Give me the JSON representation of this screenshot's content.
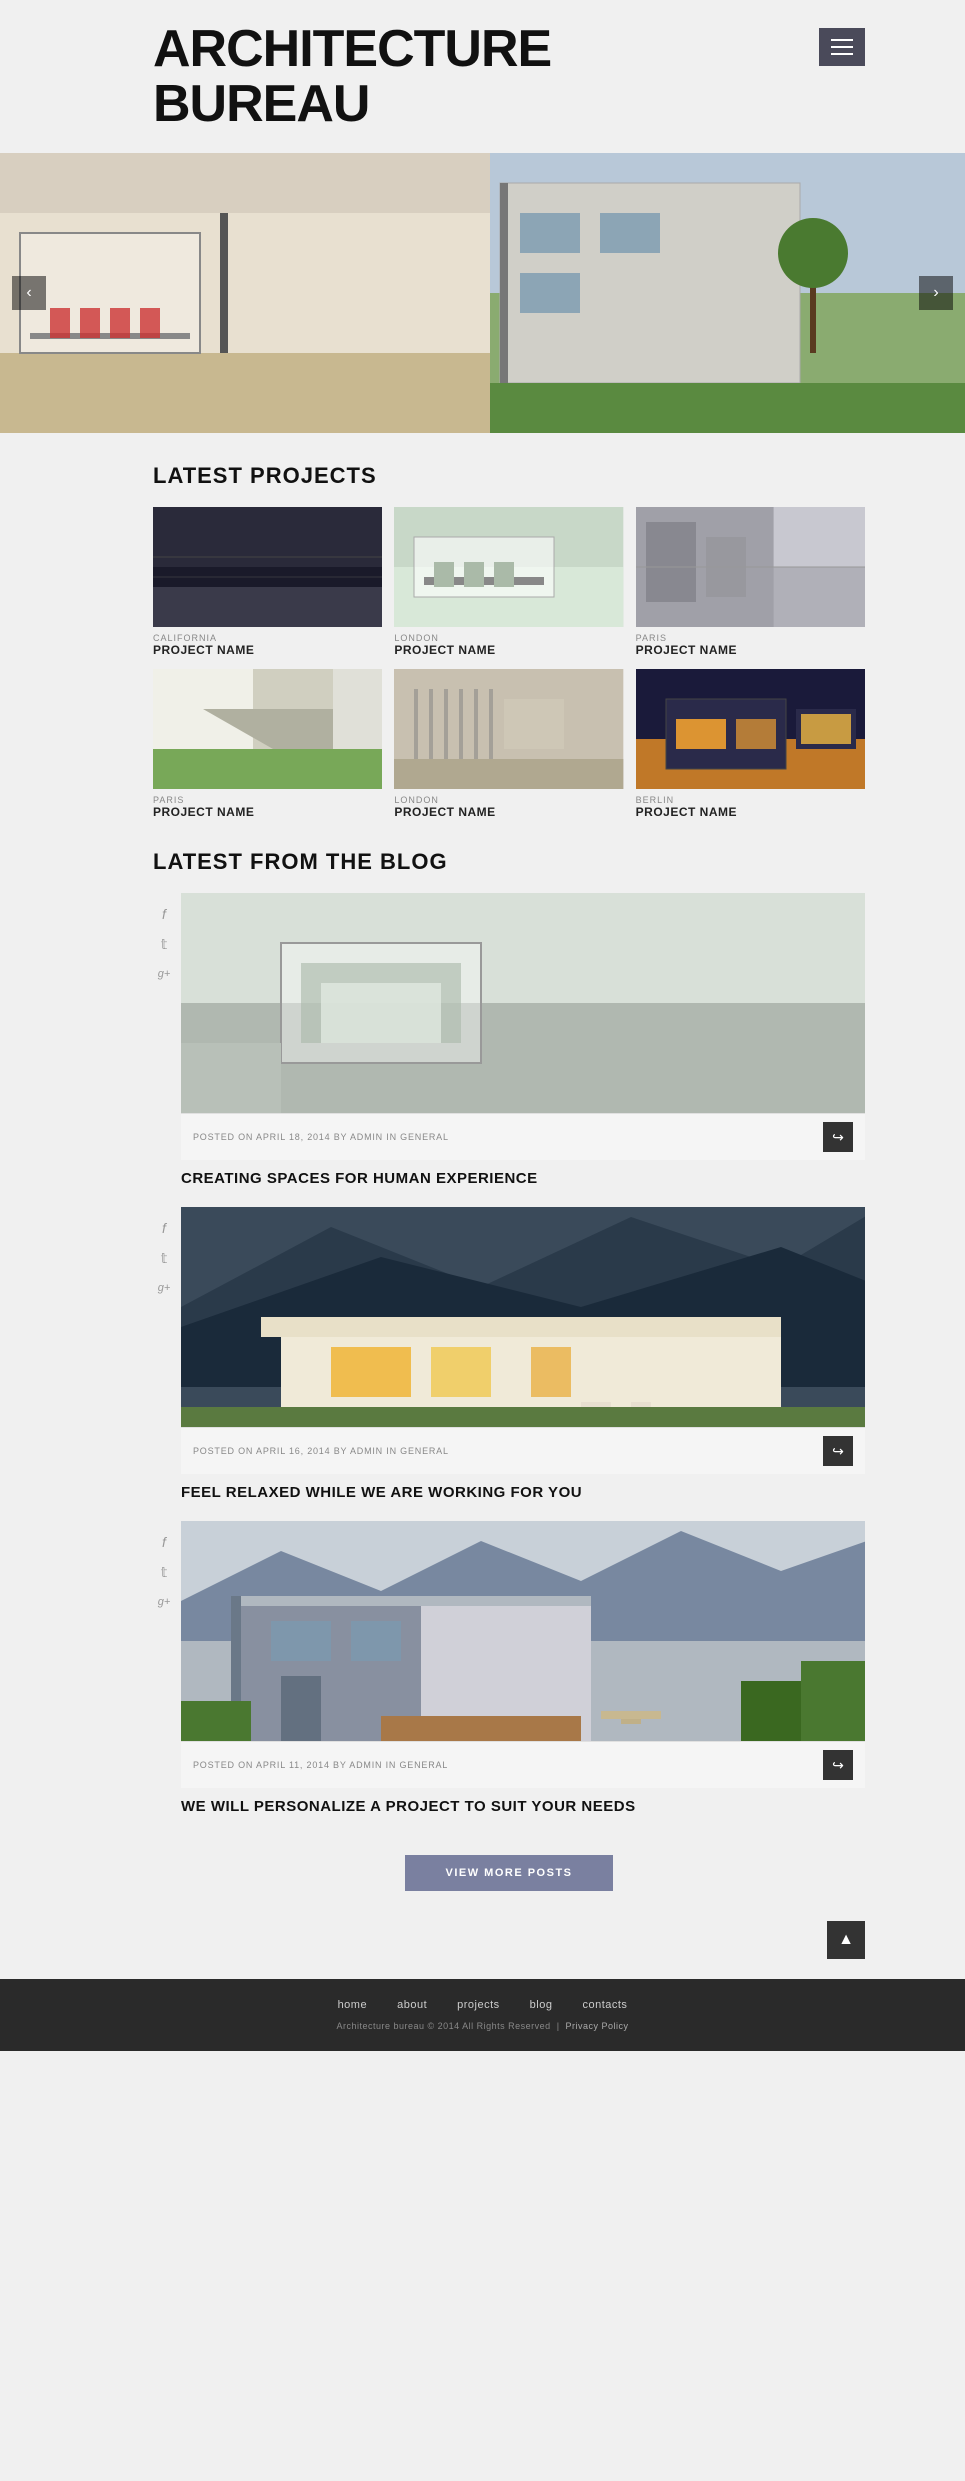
{
  "header": {
    "title": "ARCHITECTURE\nBUREAU",
    "menu_label": "menu"
  },
  "hero": {
    "prev_label": "‹",
    "next_label": "›"
  },
  "latest_projects": {
    "section_title": "LATEST PROJECTS",
    "projects": [
      {
        "location": "CALIFORNIA",
        "name": "PROJECT NAME",
        "img_class": "proj-img-1"
      },
      {
        "location": "LONDON",
        "name": "PROJECT NAME",
        "img_class": "proj-img-2"
      },
      {
        "location": "PARIS",
        "name": "PROJECT NAME",
        "img_class": "proj-img-3"
      },
      {
        "location": "PARIS",
        "name": "PROJECT NAME",
        "img_class": "proj-img-4"
      },
      {
        "location": "LONDON",
        "name": "PROJECT NAME",
        "img_class": "proj-img-5"
      },
      {
        "location": "BERLIN",
        "name": "PROJECT NAME",
        "img_class": "proj-img-6"
      }
    ]
  },
  "blog": {
    "section_title": "LATEST FROM THE BLOG",
    "posts": [
      {
        "meta": "POSTED ON APRIL 18, 2014 BY ADMIN IN GENERAL",
        "title": "CREATING SPACES FOR HUMAN EXPERIENCE",
        "img_class": "blog-img-1",
        "social": [
          "f",
          "t",
          "g+"
        ]
      },
      {
        "meta": "POSTED ON APRIL 16, 2014 BY ADMIN IN GENERAL",
        "title": "FEEL RELAXED WHILE WE ARE WORKING FOR YOU",
        "img_class": "blog-img-2",
        "social": [
          "f",
          "t",
          "g+"
        ]
      },
      {
        "meta": "POSTED ON APRIL 11, 2014 BY ADMIN IN GENERAL",
        "title": "WE WILL PERSONALIZE A PROJECT TO SUIT YOUR NEEDS",
        "img_class": "blog-img-3",
        "social": [
          "f",
          "t",
          "g+"
        ]
      }
    ],
    "view_more_label": "VIEW MORE POSTS"
  },
  "footer": {
    "nav": [
      {
        "label": "home"
      },
      {
        "label": "about"
      },
      {
        "label": "projects"
      },
      {
        "label": "blog"
      },
      {
        "label": "contacts"
      }
    ],
    "copyright": "Architecture bureau © 2014 All Rights Reserved",
    "privacy_label": "Privacy Policy"
  },
  "scroll_top_icon": "▲"
}
